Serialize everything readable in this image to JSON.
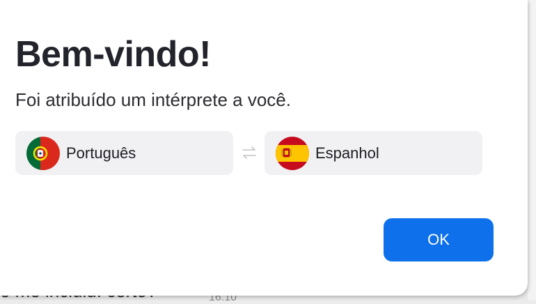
{
  "dialog": {
    "title": "Bem-vindo!",
    "subtitle": "Foi atribuído um intérprete a você.",
    "source_language": {
      "label": "Português",
      "flag_icon": "portugal-flag-icon"
    },
    "swap_icon": "swap-arrows-icon",
    "target_language": {
      "label": "Espanhol",
      "flag_icon": "spain-flag-icon"
    },
    "ok_label": "OK"
  },
  "background": {
    "message_fragment": "e me incluiu. certo?",
    "timestamp": "16:10"
  },
  "colors": {
    "accent": "#0e71eb",
    "language_box": "#f1f1f4",
    "title_text": "#22232b"
  }
}
